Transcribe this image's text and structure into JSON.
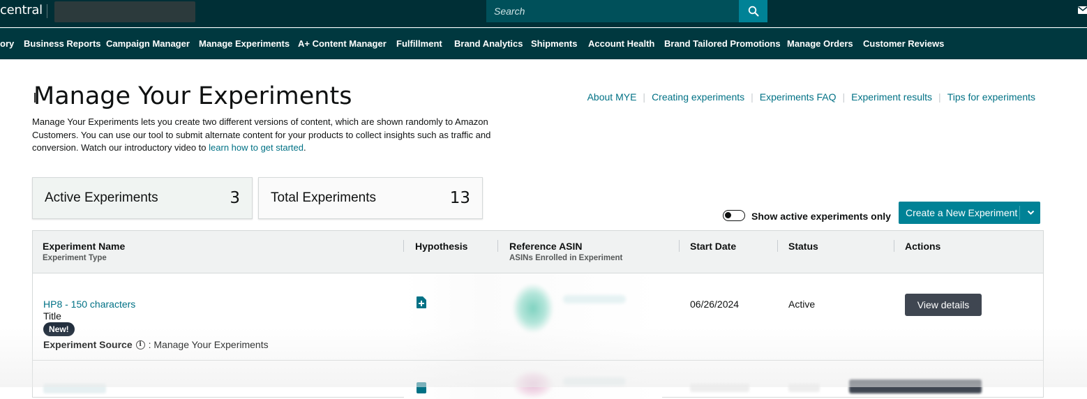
{
  "topbar": {
    "brand_text": "central",
    "search_placeholder": "Search",
    "icons": {
      "search": "search-icon",
      "mail": "mail-icon"
    }
  },
  "nav": {
    "items": [
      {
        "label": "ory"
      },
      {
        "label": "Business Reports"
      },
      {
        "label": "Campaign Manager"
      },
      {
        "label": "Manage Experiments"
      },
      {
        "label": "A+ Content Manager"
      },
      {
        "label": "Fulfillment"
      },
      {
        "label": "Brand Analytics"
      },
      {
        "label": "Shipments"
      },
      {
        "label": "Account Health"
      },
      {
        "label": "Brand Tailored Promotions"
      },
      {
        "label": "Manage Orders"
      },
      {
        "label": "Customer Reviews"
      }
    ]
  },
  "header": {
    "title": "Manage Your Experiments",
    "intro_text": "Manage Your Experiments lets you create two different versions of content, which are shown randomly to Amazon Customers. You can use our tool to submit alternate content for your products to collect insights such as traffic and conversion. Watch our introductory video to ",
    "intro_link": "learn how to get started",
    "intro_end": ".",
    "links": [
      {
        "label": "About MYE"
      },
      {
        "label": "Creating experiments"
      },
      {
        "label": "Experiments FAQ"
      },
      {
        "label": "Experiment results"
      },
      {
        "label": "Tips for experiments"
      }
    ],
    "link_separator": "|"
  },
  "stats": {
    "active": {
      "label": "Active Experiments",
      "value": "3"
    },
    "total": {
      "label": "Total Experiments",
      "value": "13"
    }
  },
  "controls": {
    "toggle_label": "Show active experiments only",
    "toggle_on": false,
    "create_button": "Create a New Experiment"
  },
  "table": {
    "columns": {
      "name": "Experiment Name",
      "name_sub": "Experiment Type",
      "hypothesis": "Hypothesis",
      "asin": "Reference ASIN",
      "asin_sub": "ASINs Enrolled in Experiment",
      "start_date": "Start Date",
      "status": "Status",
      "actions": "Actions"
    },
    "rows": [
      {
        "name": "HP8 - 150 characters",
        "type": "Title",
        "badge": "New!",
        "source_label": "Experiment Source",
        "source_value": ": Manage Your Experiments",
        "start_date": "06/26/2024",
        "status": "Active",
        "action": "View details"
      }
    ]
  },
  "colors": {
    "topbar": "#002f36",
    "navbar": "#00383f",
    "accent": "#008296",
    "link": "#007185",
    "dark_button": "#3f4651"
  }
}
